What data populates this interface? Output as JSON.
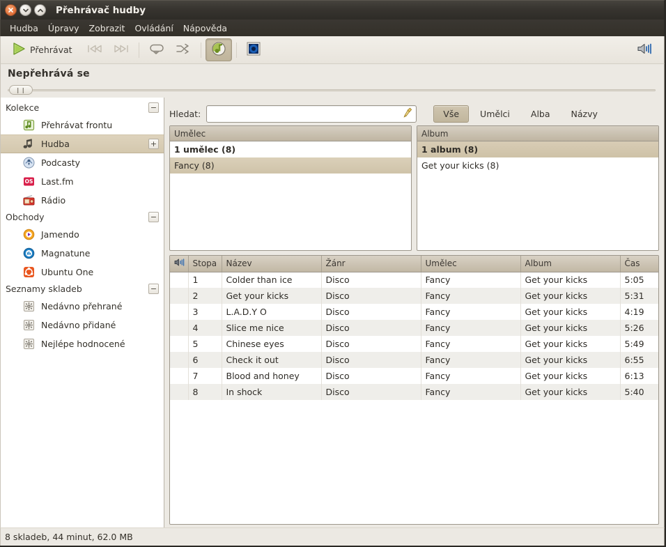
{
  "window": {
    "title": "Přehrávač hudby",
    "buttons": {
      "close": "close-icon",
      "minimize": "minimize-icon",
      "maximize": "maximize-icon"
    }
  },
  "menubar": {
    "items": [
      {
        "label": "Hudba"
      },
      {
        "label": "Úpravy"
      },
      {
        "label": "Zobrazit"
      },
      {
        "label": "Ovládání"
      },
      {
        "label": "Nápověda"
      }
    ]
  },
  "toolbar": {
    "play_label": "Přehrávat",
    "play_icon": "play-icon",
    "previous_icon": "previous-icon",
    "next_icon": "next-icon",
    "repeat_icon": "repeat-icon",
    "shuffle_icon": "shuffle-icon",
    "browse_icon": "browse-icon",
    "visualization_icon": "visualization-icon",
    "volume_icon": "volume-icon"
  },
  "now_playing": {
    "status": "Nepřehrává se",
    "seek_position": 0,
    "handle_glyph": "❙❙"
  },
  "sidebar": {
    "groups": [
      {
        "title": "Kolekce",
        "expander": "−",
        "items": [
          {
            "label": "Přehrávat frontu",
            "icon": "queue-icon",
            "selected": false,
            "expander": ""
          },
          {
            "label": "Hudba",
            "icon": "music-note-icon",
            "selected": true,
            "expander": "+"
          },
          {
            "label": "Podcasty",
            "icon": "podcast-icon",
            "selected": false,
            "expander": ""
          },
          {
            "label": "Last.fm",
            "icon": "lastfm-icon",
            "selected": false,
            "expander": ""
          },
          {
            "label": "Rádio",
            "icon": "radio-icon",
            "selected": false,
            "expander": ""
          }
        ]
      },
      {
        "title": "Obchody",
        "expander": "−",
        "items": [
          {
            "label": "Jamendo",
            "icon": "jamendo-icon",
            "selected": false,
            "expander": ""
          },
          {
            "label": "Magnatune",
            "icon": "magnatune-icon",
            "selected": false,
            "expander": ""
          },
          {
            "label": "Ubuntu One",
            "icon": "ubuntu-one-icon",
            "selected": false,
            "expander": ""
          }
        ]
      },
      {
        "title": "Seznamy skladeb",
        "expander": "−",
        "items": [
          {
            "label": "Nedávno přehrané",
            "icon": "auto-playlist-icon",
            "selected": false,
            "expander": ""
          },
          {
            "label": "Nedávno přidané",
            "icon": "auto-playlist-icon",
            "selected": false,
            "expander": ""
          },
          {
            "label": "Nejlépe hodnocené",
            "icon": "auto-playlist-icon",
            "selected": false,
            "expander": ""
          }
        ]
      }
    ]
  },
  "search": {
    "label": "Hledat:",
    "value": "",
    "placeholder": "",
    "clear_icon": "broom-clear-icon"
  },
  "filters": {
    "items": [
      {
        "label": "Vše",
        "active": true
      },
      {
        "label": "Umělci",
        "active": false
      },
      {
        "label": "Alba",
        "active": false
      },
      {
        "label": "Názvy",
        "active": false
      }
    ]
  },
  "browsers": {
    "artist": {
      "header": "Umělec",
      "all_row": "1 umělec (8)",
      "rows": [
        {
          "label": "Fancy (8)",
          "selected": true
        }
      ]
    },
    "album": {
      "header": "Album",
      "all_row": "1 album (8)",
      "all_selected": true,
      "rows": [
        {
          "label": "Get your kicks (8)",
          "selected": false
        }
      ]
    }
  },
  "tracklist": {
    "columns": [
      {
        "key": "icon",
        "label": "",
        "icon": "speaker-icon"
      },
      {
        "key": "track",
        "label": "Stopa"
      },
      {
        "key": "title",
        "label": "Název"
      },
      {
        "key": "genre",
        "label": "Žánr"
      },
      {
        "key": "artist",
        "label": "Umělec"
      },
      {
        "key": "album",
        "label": "Album"
      },
      {
        "key": "time",
        "label": "Čas"
      }
    ],
    "rows": [
      {
        "track": "1",
        "title": "Colder than ice",
        "genre": "Disco",
        "artist": "Fancy",
        "album": "Get your kicks",
        "time": "5:05"
      },
      {
        "track": "2",
        "title": "Get your kicks",
        "genre": "Disco",
        "artist": "Fancy",
        "album": "Get your kicks",
        "time": "5:31"
      },
      {
        "track": "3",
        "title": "L.A.D.Y O",
        "genre": "Disco",
        "artist": "Fancy",
        "album": "Get your kicks",
        "time": "4:19"
      },
      {
        "track": "4",
        "title": "Slice me nice",
        "genre": "Disco",
        "artist": "Fancy",
        "album": "Get your kicks",
        "time": "5:26"
      },
      {
        "track": "5",
        "title": "Chinese eyes",
        "genre": "Disco",
        "artist": "Fancy",
        "album": "Get your kicks",
        "time": "5:49"
      },
      {
        "track": "6",
        "title": "Check it out",
        "genre": "Disco",
        "artist": "Fancy",
        "album": "Get your kicks",
        "time": "6:55"
      },
      {
        "track": "7",
        "title": "Blood and honey",
        "genre": "Disco",
        "artist": "Fancy",
        "album": "Get your kicks",
        "time": "6:13"
      },
      {
        "track": "8",
        "title": "In shock",
        "genre": "Disco",
        "artist": "Fancy",
        "album": "Get your kicks",
        "time": "5:40"
      }
    ]
  },
  "statusbar": {
    "text": "8 skladeb, 44 minut, 62.0 MB"
  },
  "colors": {
    "titlebar": "#37342f",
    "chrome": "#ece9e3",
    "selection": "#d4c8ae",
    "accent_close": "#e0703a",
    "play_green": "#8fbe3f",
    "text": "#2f2c27"
  }
}
